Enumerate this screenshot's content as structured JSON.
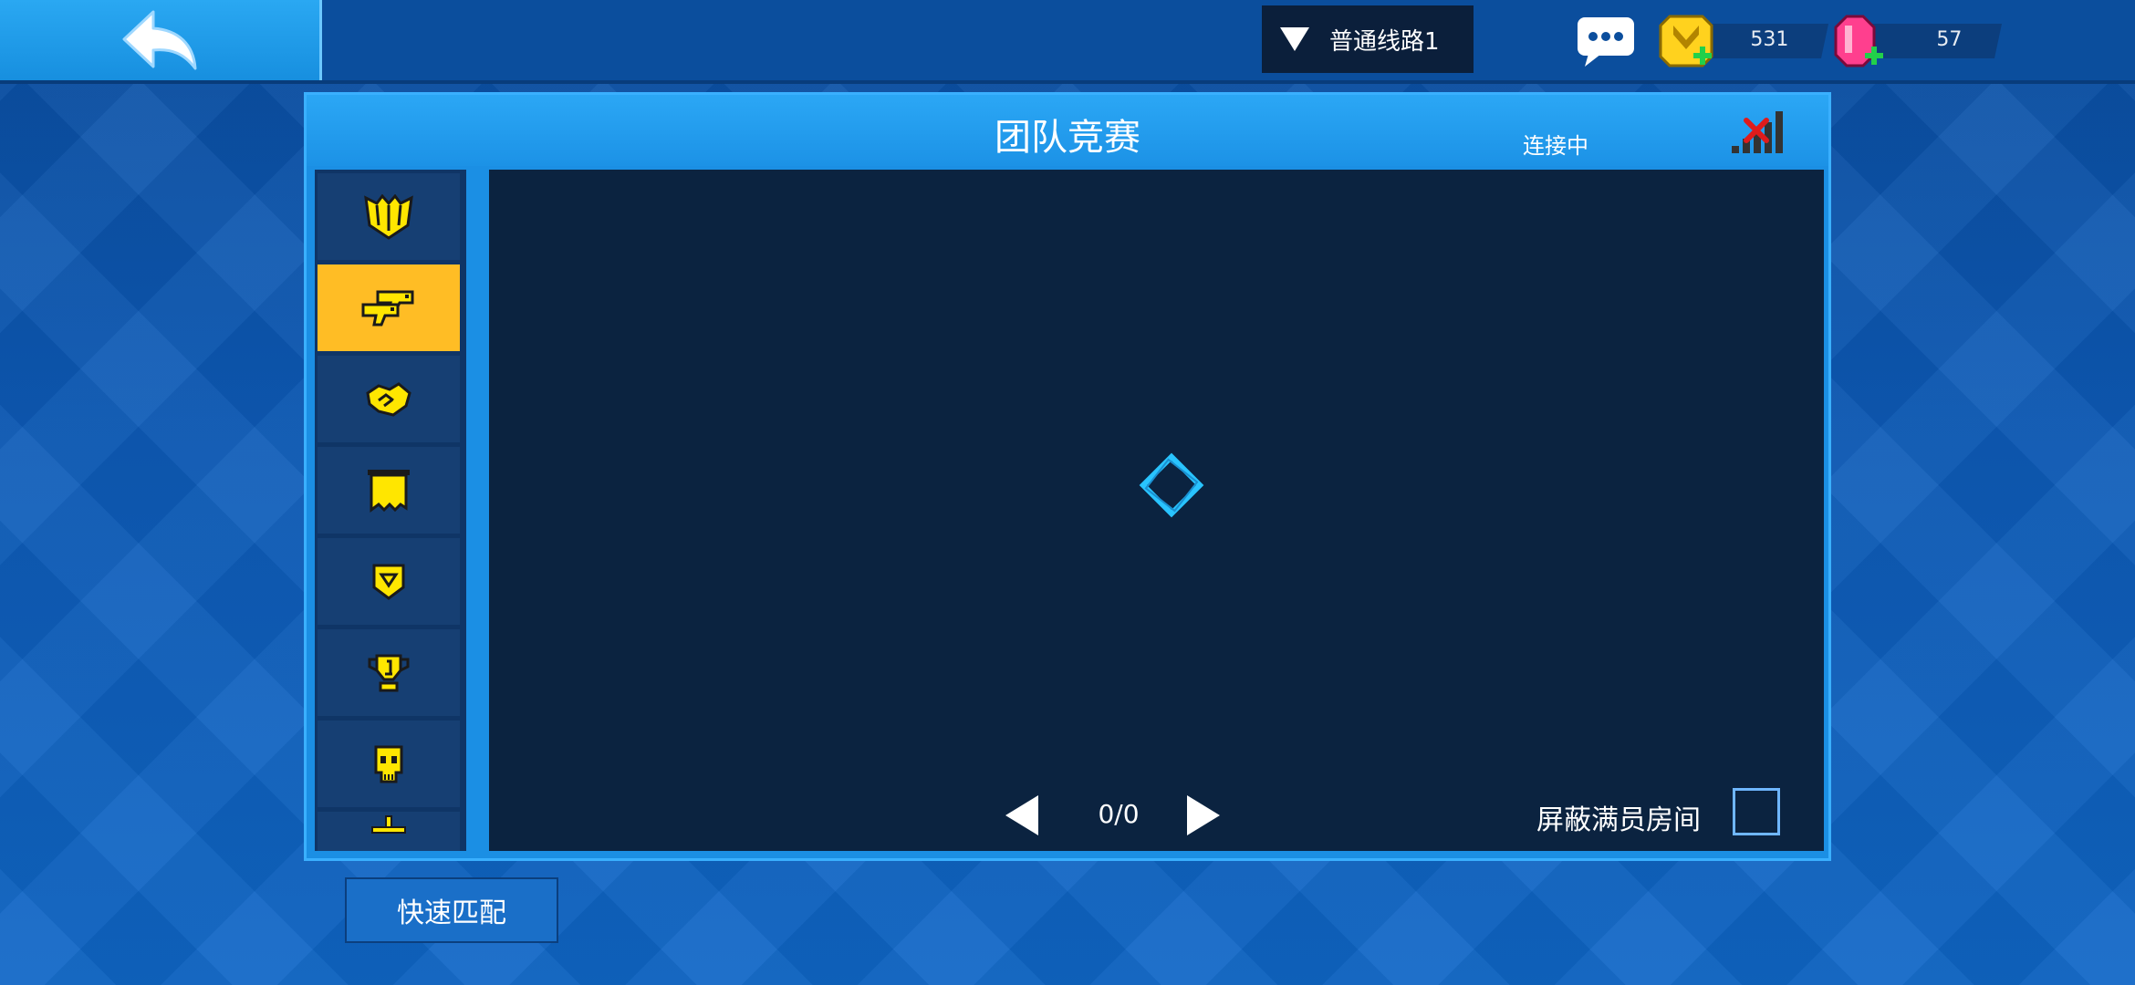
{
  "topbar": {
    "server_label": "普通线路1",
    "coins_value": "531",
    "gems_value": "57"
  },
  "panel": {
    "title": "团队竞赛",
    "status": "连接中"
  },
  "sidebar": {
    "items": [
      {
        "icon": "crown-trident-icon",
        "selected": false
      },
      {
        "icon": "dual-pistols-icon",
        "selected": true
      },
      {
        "icon": "handshake-icon",
        "selected": false
      },
      {
        "icon": "banner-flag-icon",
        "selected": false
      },
      {
        "icon": "shield-badge-icon",
        "selected": false
      },
      {
        "icon": "trophy-icon",
        "selected": false
      },
      {
        "icon": "skull-icon",
        "selected": false
      },
      {
        "icon": "sword-icon",
        "selected": false
      }
    ]
  },
  "content": {
    "pager": "0/0",
    "hide_full_label": "屏蔽满员房间"
  },
  "footer": {
    "quick_match_label": "快速匹配"
  },
  "colors": {
    "accent": "#1b8fe4",
    "selected": "#ffbd25",
    "icon_yellow": "#ffe600"
  }
}
